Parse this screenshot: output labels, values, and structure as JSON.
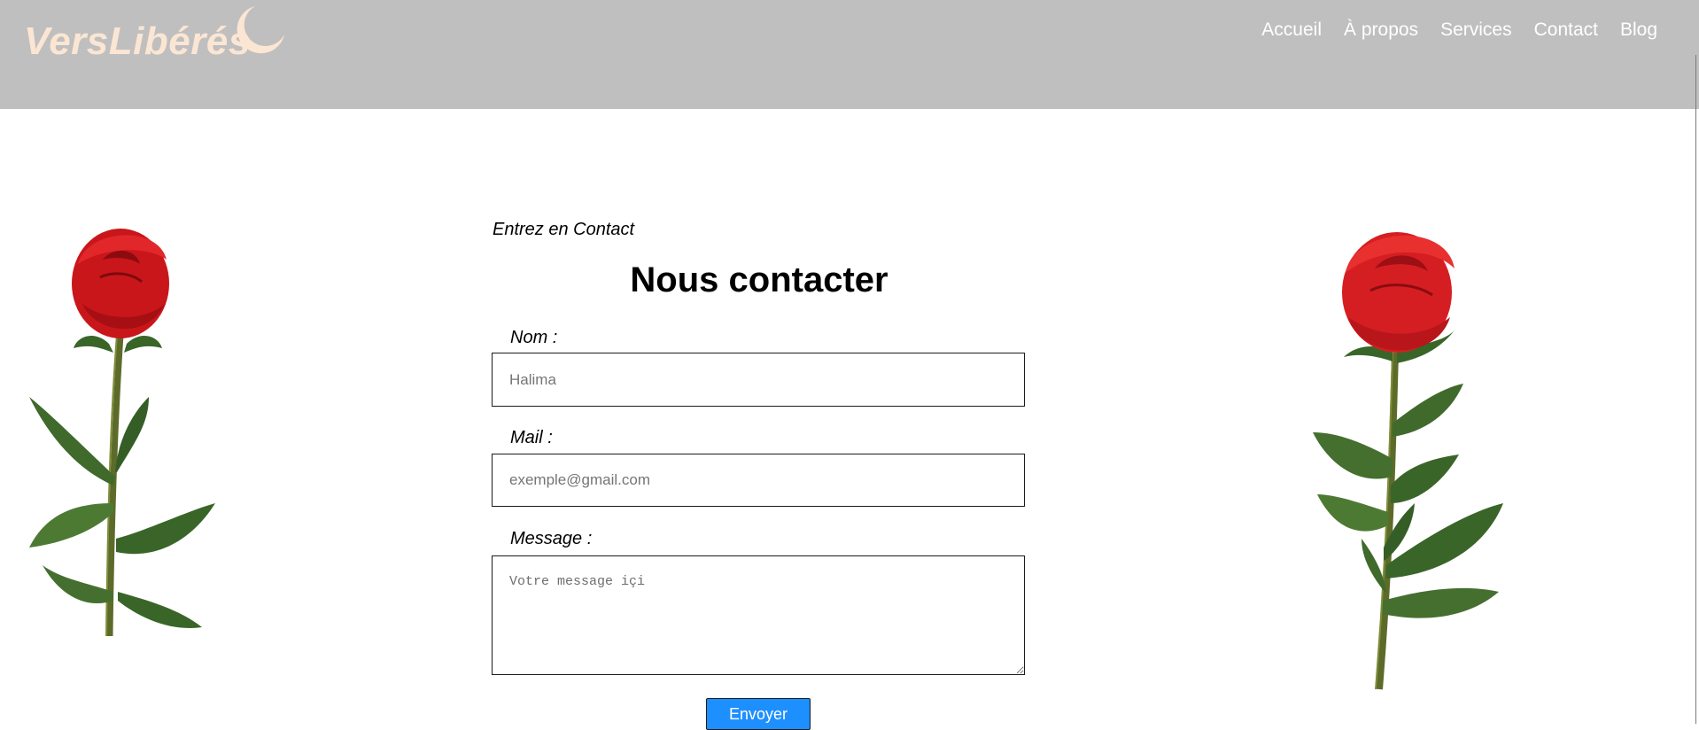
{
  "brand": {
    "name": "VersLibérés",
    "text_color": "#fbe6d3",
    "moon_color": "#fbe6d3",
    "header_bg": "#bfbfbf"
  },
  "nav": [
    {
      "label": "Accueil"
    },
    {
      "label": "À propos"
    },
    {
      "label": "Services"
    },
    {
      "label": "Contact"
    },
    {
      "label": "Blog"
    }
  ],
  "contact": {
    "kicker": "Entrez en Contact",
    "title": "Nous contacter",
    "name_label": "Nom :",
    "name_placeholder": "Halima",
    "mail_label": "Mail :",
    "mail_placeholder": "exemple@gmail.com",
    "message_label": "Message :",
    "message_placeholder": "Votre message içi",
    "submit_label": "Envoyer",
    "submit_color": "#1e8fff"
  },
  "images": {
    "left": "rose-image",
    "right": "rose-image"
  }
}
